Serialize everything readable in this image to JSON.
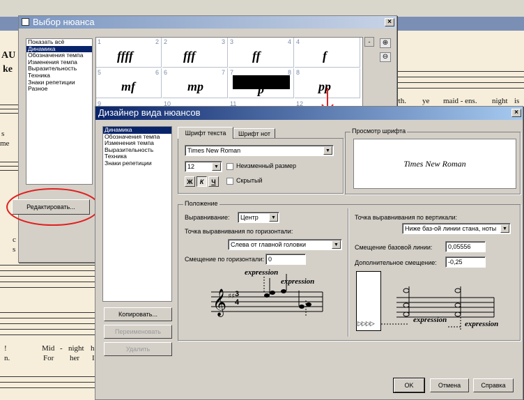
{
  "score": {
    "lyrics_left": [
      "AU",
      "ke",
      "s",
      "me",
      "c",
      "s",
      "!",
      "n."
    ],
    "lyrics_mid": [
      "Mid",
      "-",
      "night",
      "h",
      "For",
      "her",
      "I"
    ],
    "lyrics_right": [
      "rth.",
      "ye",
      "maid - ens.",
      "night",
      "is"
    ]
  },
  "selector": {
    "title": "Выбор нюанса",
    "close": "×",
    "categories": [
      "Показать всё",
      "Динамика",
      "Обозначения темпа",
      "Изменения темпа",
      "Выразительность",
      "Техника",
      "Знаки репетиции",
      "Разное"
    ],
    "selected_index": 1,
    "cells": [
      {
        "n": "1",
        "r": "2",
        "glyph": "ffff"
      },
      {
        "n": "2",
        "r": "3",
        "glyph": "fff"
      },
      {
        "n": "3",
        "r": "4",
        "glyph": "ff"
      },
      {
        "n": "4",
        "r": "",
        "glyph": "f"
      },
      {
        "n": "5",
        "r": "6",
        "glyph": "mf"
      },
      {
        "n": "6",
        "r": "7",
        "glyph": "mp"
      },
      {
        "n": "7",
        "r": "8",
        "glyph": "p"
      },
      {
        "n": "8",
        "r": "",
        "glyph": "pp"
      }
    ],
    "row3_numbers": [
      "9",
      "10",
      "11",
      "12"
    ],
    "edit_button": "Редактировать..."
  },
  "designer": {
    "title": "Дизайнер вида нюансов",
    "close": "×",
    "categories": [
      "Динамика",
      "Обозначения темпа",
      "Изменения темпа",
      "Выразительность",
      "Техника",
      "Знаки репетиции"
    ],
    "selected_index": 0,
    "copy_button": "Копировать...",
    "rename_button": "Переименовать",
    "delete_button": "Удалить",
    "tabs": [
      "Шрифт текста",
      "Шрифт нот"
    ],
    "font": {
      "name": "Times New Roman",
      "size": "12",
      "fixed_size_label": "Неизменный размер",
      "hidden_label": "Скрытый",
      "bold": "Ж",
      "italic": "К",
      "underline": "Ч"
    },
    "preview": {
      "label": "Просмотр шрифта",
      "text": "Times New Roman"
    },
    "position": {
      "label": "Положение",
      "alignment_label": "Выравнивание:",
      "alignment_value": "Центр",
      "h_point_label": "Точка выравнивания по горизонтали:",
      "h_point_value": "Слева от главной головки",
      "h_offset_label": "Смещение по горизонтали:",
      "h_offset_value": "0",
      "v_point_label": "Точка выравнивания по вертикали:",
      "v_point_value": "Ниже баз-ой линии стана, ноты",
      "baseline_offset_label": "Смещение базовой линии:",
      "baseline_offset_value": "0,05556",
      "extra_offset_label": "Дополнительное смещение:",
      "extra_offset_value": "-0,25"
    },
    "illustration": {
      "word": "expression",
      "time_sig_top": "3",
      "time_sig_bottom": "4",
      "arrows": "▷▷▷▷"
    },
    "ok": "OK",
    "cancel": "Отмена",
    "help": "Справка"
  },
  "colors": {
    "title_active": "#0a246a",
    "title_gradient_end": "#a6caf0",
    "title_inactive": "#7b96c0",
    "annotation_red": "#e02020"
  }
}
